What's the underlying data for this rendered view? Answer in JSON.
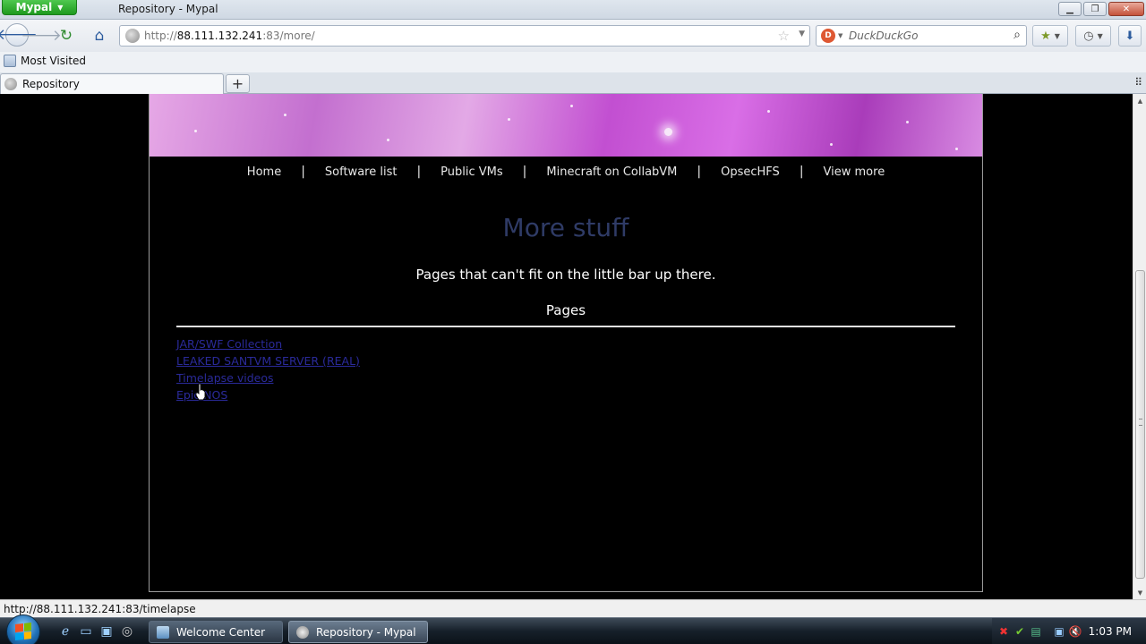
{
  "window": {
    "app_menu_label": "Mypal",
    "title": "Repository - Mypal",
    "controls": [
      "minimize",
      "restore",
      "close"
    ]
  },
  "toolbar": {
    "back_icon": "arrow-left-icon",
    "url_scheme": "http://",
    "url_host": "88.111.132.241",
    "url_rest": ":83/more/",
    "search_placeholder": "DuckDuckGo"
  },
  "bookmarks": {
    "items": [
      {
        "label": "Most Visited"
      }
    ]
  },
  "tabs": [
    {
      "label": "Repository",
      "active": true
    }
  ],
  "page": {
    "nav": [
      {
        "label": "Home"
      },
      {
        "label": "Software list"
      },
      {
        "label": "Public VMs"
      },
      {
        "label": "Minecraft on CollabVM"
      },
      {
        "label": "OpsecHFS"
      },
      {
        "label": "View more"
      }
    ],
    "nav_separator": "|",
    "heading": "More stuff",
    "subtext": "Pages that can't fit on the little bar up there.",
    "section_title": "Pages",
    "links": [
      {
        "label": "JAR/SWF Collection"
      },
      {
        "label": "LEAKED SANTVM SERVER (REAL)"
      },
      {
        "label": "Timelapse videos"
      },
      {
        "label": "Epic NOS"
      }
    ],
    "colors": {
      "heading": "#2f3b66",
      "link": "#2a2a9a",
      "background": "#000000"
    }
  },
  "statusbar": {
    "text": "http://88.111.132.241:83/timelapse"
  },
  "taskbar": {
    "buttons": [
      {
        "label": "Welcome Center",
        "active": false
      },
      {
        "label": "Repository - Mypal",
        "active": true
      }
    ],
    "clock": "1:03 PM"
  }
}
